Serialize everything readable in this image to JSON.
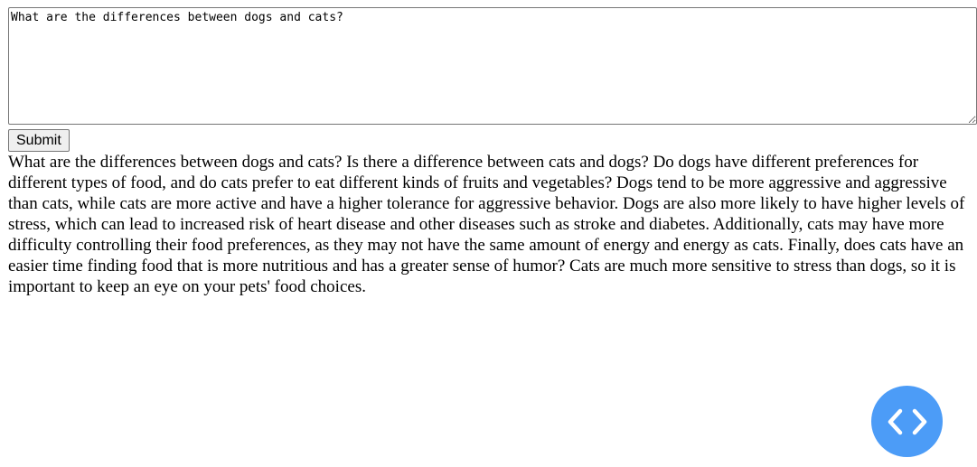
{
  "prompt": {
    "value": "What are the differences between dogs and cats?"
  },
  "submit": {
    "label": "Submit"
  },
  "output": {
    "text": "What are the differences between dogs and cats? Is there a difference between cats and dogs? Do dogs have different preferences for different types of food, and do cats prefer to eat different kinds of fruits and vegetables? Dogs tend to be more aggressive and aggressive than cats, while cats are more active and have a higher tolerance for aggressive behavior. Dogs are also more likely to have higher levels of stress, which can lead to increased risk of heart disease and other diseases such as stroke and diabetes. Additionally, cats may have more difficulty controlling their food preferences, as they may not have the same amount of energy and energy as cats. Finally, does cats have an easier time finding food that is more nutritious and has a greater sense of humor? Cats are much more sensitive to stress than dogs, so it is important to keep an eye on your pets' food choices."
  },
  "fab": {
    "icon": "code-icon",
    "color": "#4c9cf7"
  }
}
